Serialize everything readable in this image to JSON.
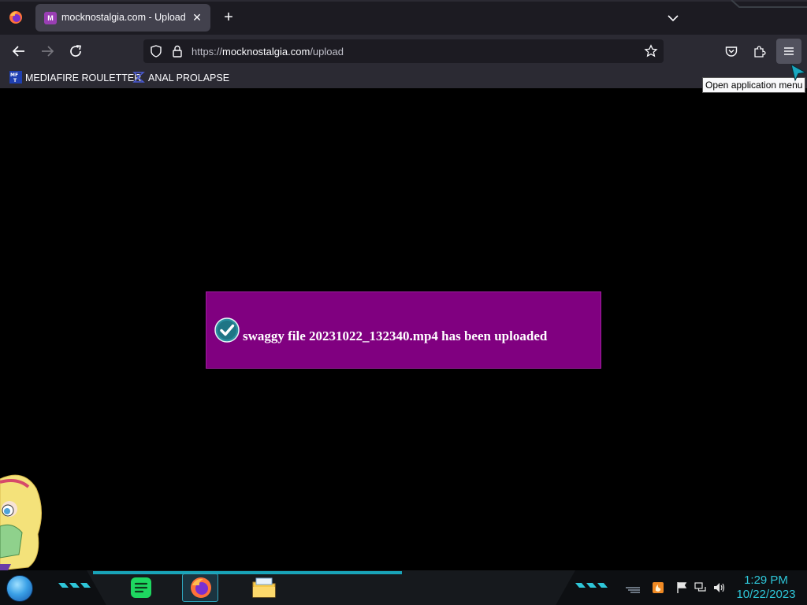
{
  "browser": {
    "tab": {
      "title": "mocknostalgia.com - Upload",
      "favicon_letter": "M",
      "close_glyph": "✕"
    },
    "newtab_glyph": "+",
    "url": {
      "prefix": "https://",
      "domain": "mocknostalgia.com",
      "path": "/upload"
    },
    "bookmarks": [
      {
        "label": "MEDIAFIRE ROULETTER",
        "icon": "mediafire-icon"
      },
      {
        "label": "ANAL PROLAPSE",
        "icon": "sigma-icon"
      }
    ],
    "tooltip": "Open application menu"
  },
  "page": {
    "notice": "swaggy file 20231022_132340.mp4 has been uploaded"
  },
  "taskbar": {
    "time": "1:29 PM",
    "date": "10/22/2023",
    "pinned": [
      "spotify-icon",
      "firefox-icon",
      "file-explorer-icon"
    ],
    "tray": [
      "flame-icon",
      "action-center-flag-icon",
      "network-icon",
      "volume-icon"
    ]
  },
  "colors": {
    "accent": "#2ec6d8",
    "notice_bg": "#800080",
    "chrome_dark": "#1c1b22",
    "chrome": "#2b2a33"
  }
}
